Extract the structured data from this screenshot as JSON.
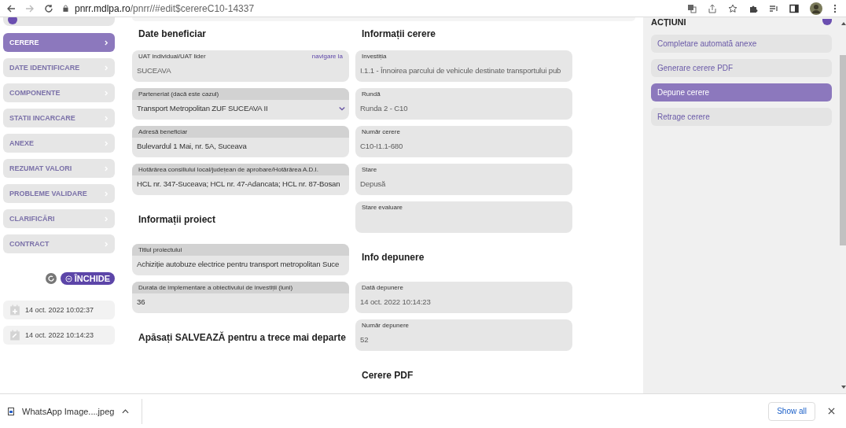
{
  "browser": {
    "url_host": "pnrr.mdlpa.ro",
    "url_path": "/pnrr//#edit$cerereC10-14337"
  },
  "sidebar": {
    "items": [
      {
        "label": "CERERE",
        "selected": true
      },
      {
        "label": "DATE IDENTIFICARE",
        "selected": false
      },
      {
        "label": "COMPONENTE",
        "selected": false
      },
      {
        "label": "STATII INCARCARE",
        "selected": false
      },
      {
        "label": "ANEXE",
        "selected": false
      },
      {
        "label": "REZUMAT VALORI",
        "selected": false
      },
      {
        "label": "PROBLEME VALIDARE",
        "selected": false
      },
      {
        "label": "CLARIFICĂRI",
        "selected": false
      },
      {
        "label": "CONTRACT",
        "selected": false
      }
    ],
    "close_button": "ÎNCHIDE",
    "timestamps": [
      {
        "kind": "created",
        "text": "14 oct. 2022 10:02:37"
      },
      {
        "kind": "modified",
        "text": "14 oct. 2022 10:14:23"
      }
    ]
  },
  "columns": [
    [
      {
        "heading": "Date beneficiar",
        "fields": [
          {
            "label": "UAT individual/UAT lider",
            "link": "navigare la",
            "value": "SUCEAVA",
            "disabled": true,
            "kind": "text"
          },
          {
            "label": "Parteneriat (dacă este cazul)",
            "value": "Transport Metropolitan ZUF SUCEAVA II",
            "disabled": false,
            "kind": "select"
          },
          {
            "label": "Adresă beneficiar",
            "value": "Bulevardul 1 Mai, nr. 5A, Suceava",
            "disabled": false,
            "kind": "text"
          },
          {
            "label": "Hotărârea consiliului local/județean de aprobare/Hotărârea A.D.I.",
            "value": "HCL nr. 347-Suceava; HCL nr. 47-Adancata; HCL nr. 87-Bosan",
            "disabled": false,
            "kind": "text"
          }
        ]
      },
      {
        "heading": "Informații proiect",
        "fields": [
          {
            "label": "Titlul proiectului",
            "value": "Achiziție autobuze electrice pentru transport metropolitan Suce",
            "disabled": false,
            "kind": "text"
          },
          {
            "label": "Durata de implementare a obiectivului de investiții (luni)",
            "value": "36",
            "disabled": false,
            "kind": "text"
          }
        ]
      },
      {
        "heading": "Apăsați SALVEAZĂ pentru a trece mai departe"
      }
    ],
    [
      {
        "heading": "Informații cerere",
        "fields": [
          {
            "label": "Investiția",
            "value": "I.1.1 - Înnoirea parcului de vehicule destinate transportului pub",
            "disabled": true,
            "kind": "text"
          },
          {
            "label": "Rundă",
            "value": "Runda 2 - C10",
            "disabled": true,
            "kind": "text"
          },
          {
            "label": "Număr cerere",
            "value": "C10-I1.1-680",
            "disabled": true,
            "kind": "text"
          },
          {
            "label": "Stare",
            "value": "Depusă",
            "disabled": true,
            "kind": "text"
          },
          {
            "label": "Stare evaluare",
            "disabled": true,
            "kind": "tall"
          }
        ]
      },
      {
        "heading": "Info depunere",
        "fields": [
          {
            "label": "Dată depunere",
            "value": "14 oct. 2022 10:14:23",
            "disabled": true,
            "kind": "text"
          },
          {
            "label": "Număr depunere",
            "value": "52",
            "disabled": true,
            "kind": "text"
          }
        ]
      },
      {
        "heading": "Cerere PDF"
      }
    ]
  ],
  "actions": {
    "title": "ACȚIUNI",
    "items": [
      {
        "label": "Completare automată anexe",
        "selected": false
      },
      {
        "label": "Generare cerere PDF",
        "selected": false
      },
      {
        "label": "Depune cerere",
        "selected": true
      },
      {
        "label": "Retrage cerere",
        "selected": false
      }
    ]
  },
  "download_bar": {
    "file": "WhatsApp Image....jpeg",
    "show_all": "Show all"
  }
}
